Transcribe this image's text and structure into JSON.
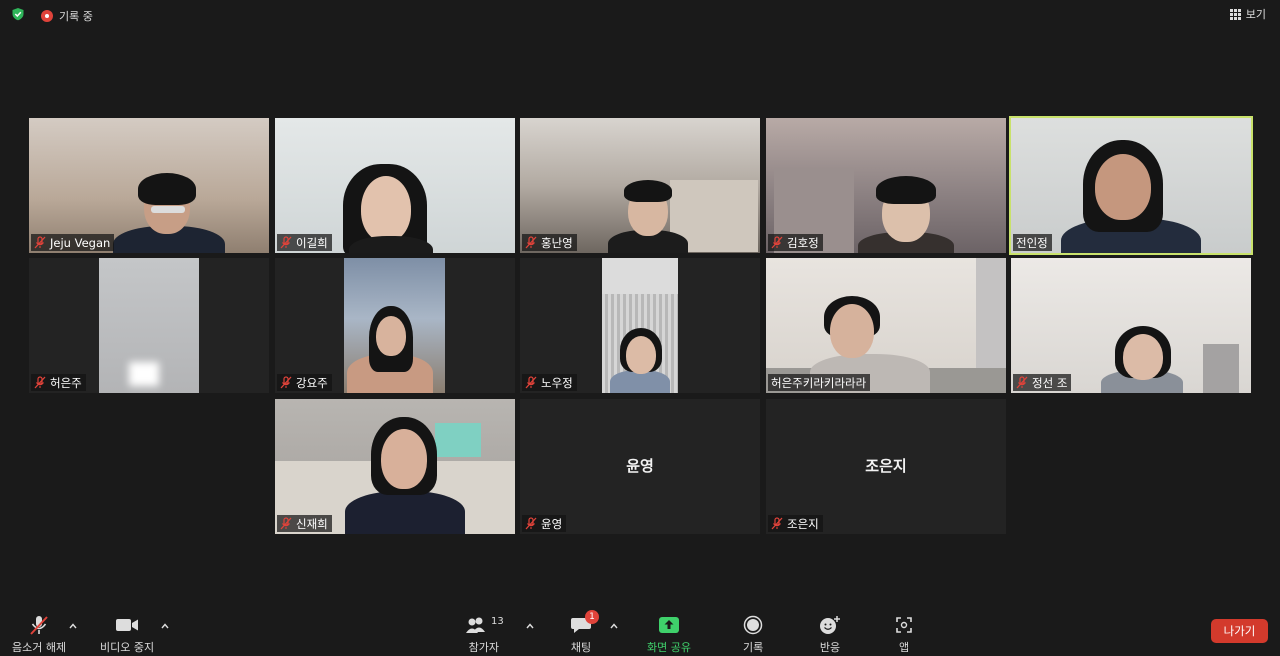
{
  "top_bar": {
    "recording_label": "기록 중",
    "view_label": "보기"
  },
  "participants": [
    {
      "name": "Jeju Vegan"
    },
    {
      "name": "이길희"
    },
    {
      "name": "홍난영"
    },
    {
      "name": "김호정"
    },
    {
      "name": "전인정"
    },
    {
      "name": "허은주"
    },
    {
      "name": "강요주"
    },
    {
      "name": "노우정"
    },
    {
      "name": "허은주키라키라라라"
    },
    {
      "name": "정선 조"
    },
    {
      "name": "신재희"
    },
    {
      "name": "윤영",
      "display_name": "윤영"
    },
    {
      "name": "조은지",
      "display_name": "조은지"
    }
  ],
  "toolbar": {
    "unmute_label": "음소거 해제",
    "video_label": "비디오 중지",
    "participants_label": "참가자",
    "participants_count": "13",
    "chat_label": "채팅",
    "chat_badge": "1",
    "share_label": "화면 공유",
    "record_label": "기록",
    "reactions_label": "반응",
    "apps_label": "앱",
    "leave_label": "나가기"
  },
  "colors": {
    "active_speaker": "#c9e26b",
    "leave": "#d33a2c",
    "share": "#3fd16b",
    "recording": "#e0433a"
  }
}
